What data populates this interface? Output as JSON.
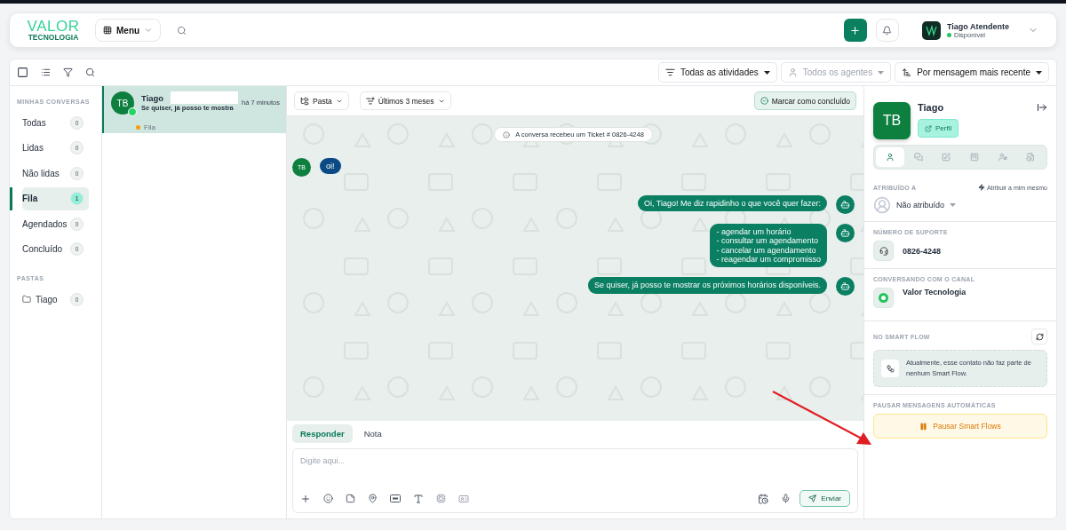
{
  "header": {
    "logo": {
      "line1": "VALOR",
      "line2": "TECNOLOGIA"
    },
    "menu_button": "Menu",
    "user": {
      "name": "Tiago Atendente",
      "status": "Disponível",
      "online": true
    }
  },
  "toolbar": {
    "select_all_checked": false,
    "filters": [
      {
        "kind": "activity",
        "label": "Todas as atividades",
        "disabled": false
      },
      {
        "kind": "agent",
        "label": "Todos os agentes",
        "disabled": true
      },
      {
        "kind": "sort",
        "label": "Por mensagem mais recente",
        "disabled": false
      }
    ]
  },
  "sidebar": {
    "sections": [
      {
        "title": "MINHAS CONVERSAS",
        "items": [
          {
            "kind": "plain",
            "label": "Todas",
            "count": "0",
            "selected": false
          },
          {
            "kind": "plain",
            "label": "Lidas",
            "count": "0",
            "selected": false
          },
          {
            "kind": "plain",
            "label": "Não lidas",
            "count": "0",
            "selected": false
          },
          {
            "kind": "plain",
            "label": "Fila",
            "count": "1",
            "selected": true
          },
          {
            "kind": "plain",
            "label": "Agendados",
            "count": "0",
            "selected": false
          },
          {
            "kind": "plain",
            "label": "Concluído",
            "count": "0",
            "selected": false
          }
        ]
      },
      {
        "title": "PASTAS",
        "items": [
          {
            "kind": "folder",
            "label": "Tiago",
            "count": "0",
            "selected": false
          }
        ]
      }
    ]
  },
  "conversations": [
    {
      "initials": "TB",
      "name": "Tiago",
      "preview": "Se quiser, já posso te mostra",
      "time": "há 7 minutos",
      "status": "Fila",
      "color": "#f59e0b",
      "selected": true
    }
  ],
  "chat": {
    "filters": [
      {
        "kind": "folder",
        "label": "Pasta"
      },
      {
        "kind": "period",
        "label": "Últimos 3 meses"
      }
    ],
    "complete_button": "Marcar como concluído",
    "notice": "A conversa recebeu um Ticket # 0826-4248",
    "messages": [
      {
        "kind": "incoming",
        "initials": "TB",
        "lines": [
          "oi!"
        ]
      },
      {
        "kind": "outgoing",
        "lines": [
          "Oi, Tiago! Me diz rapidinho o que você quer fazer:"
        ]
      },
      {
        "kind": "outgoing",
        "lines": [
          "- agendar um horário",
          "- consultar um agendamento",
          "- cancelar um agendamento",
          "- reagendar um compromisso"
        ]
      },
      {
        "kind": "outgoing",
        "lines": [
          "Se quiser, já posso te mostrar os próximos horários disponíveis."
        ]
      }
    ]
  },
  "composer": {
    "tabs": [
      {
        "label": "Responder",
        "selected": true
      },
      {
        "label": "Nota",
        "selected": false
      }
    ],
    "placeholder": "Digite aqui...",
    "send_button": "Enviar"
  },
  "contact": {
    "initials": "TB",
    "name": "Tiago",
    "profile_button": "Perfil",
    "tabs": [
      {
        "kind": "person",
        "selected": true
      },
      {
        "kind": "chat",
        "selected": false
      },
      {
        "kind": "edit",
        "selected": false
      },
      {
        "kind": "note",
        "selected": false
      },
      {
        "kind": "transfer",
        "selected": false
      },
      {
        "kind": "file",
        "selected": false
      }
    ],
    "assigned": {
      "title": "ATRIBUÍDO A",
      "assign_self": "Atribuir a mim mesmo",
      "value": "Não atribuído"
    },
    "support": {
      "title": "NÚMERO DE SUPORTE",
      "value": "0826-4248"
    },
    "channel": {
      "title": "CONVERSANDO COM O CANAL",
      "value": "Valor Tecnologia"
    },
    "smart_flow": {
      "title": "NO SMART FLOW",
      "message": "Atualmente, esse contato não faz parte de nenhum Smart Flow."
    },
    "pause": {
      "title": "PAUSAR MENSAGENS AUTOMÁTICAS",
      "button": "Pausar Smart Flows"
    }
  }
}
